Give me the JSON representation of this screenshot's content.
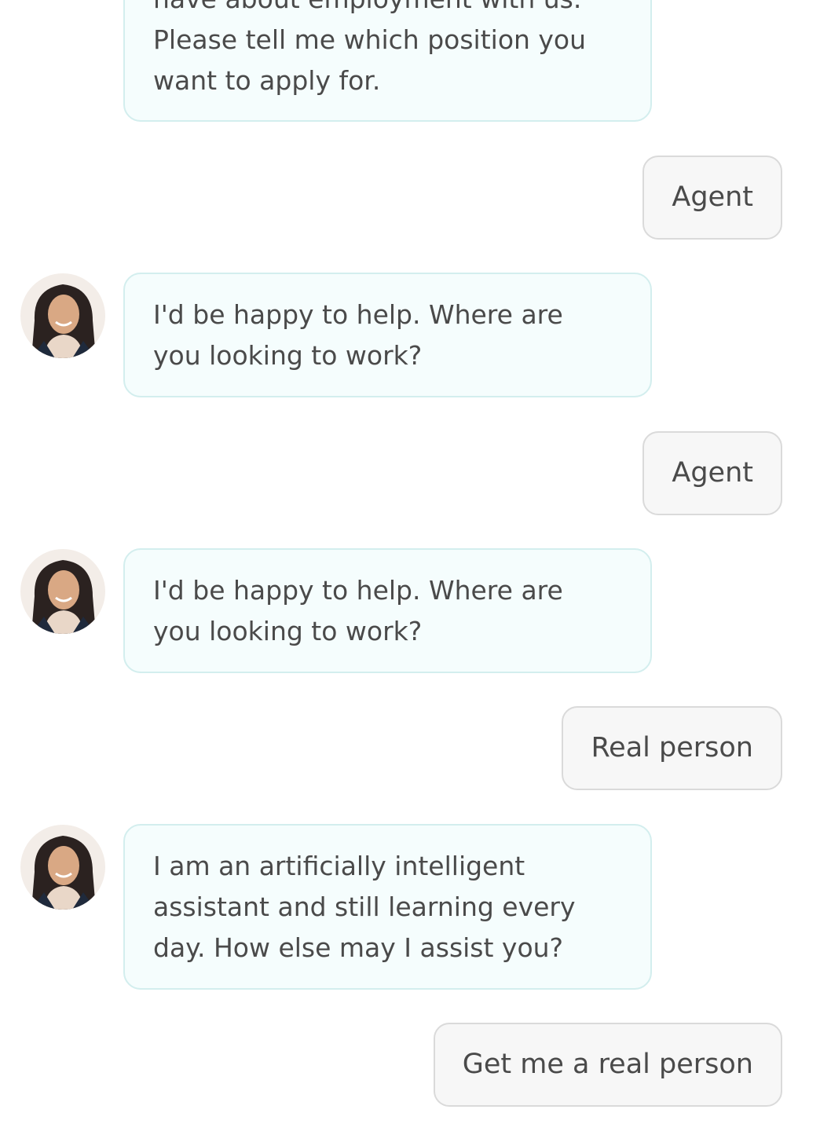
{
  "conversation": {
    "messages": [
      {
        "sender": "bot",
        "lines": [
          "have about employment with us.",
          "Please tell me which position you",
          "want to apply for."
        ]
      },
      {
        "sender": "user",
        "text": "Agent"
      },
      {
        "sender": "bot",
        "lines": [
          "I'd be happy to help. Where are",
          "you looking to work?"
        ]
      },
      {
        "sender": "user",
        "text": "Agent"
      },
      {
        "sender": "bot",
        "lines": [
          "I'd be happy to help. Where are",
          "you looking to work?"
        ]
      },
      {
        "sender": "user",
        "text": "Real person"
      },
      {
        "sender": "bot",
        "lines": [
          "I am an artificially intelligent",
          "assistant and still learning every",
          "day. How else may I assist you?"
        ]
      },
      {
        "sender": "user",
        "text": "Get me a real person"
      }
    ]
  },
  "colors": {
    "bot_bubble_bg": "#f5fdfd",
    "bot_bubble_border": "#d3eeee",
    "user_bubble_bg": "#f7f7f7",
    "user_bubble_border": "#dadada",
    "text": "#4a4a4a"
  },
  "icons": {
    "avatar": "assistant-avatar-photo"
  }
}
